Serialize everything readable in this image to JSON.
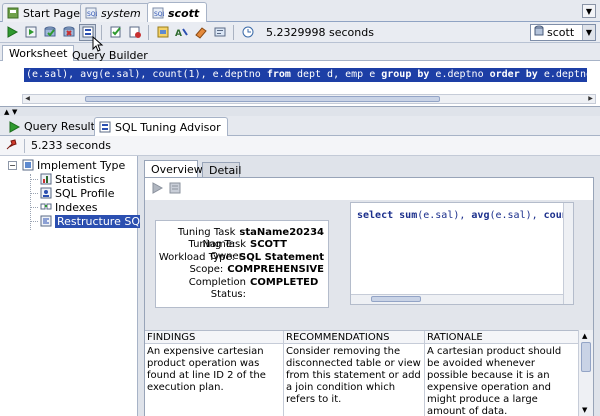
{
  "tabs": [
    {
      "label": "Start Page",
      "icon": "start-page-icon"
    },
    {
      "label": "system",
      "icon": "sql-worksheet-icon"
    },
    {
      "label": "scott",
      "icon": "sql-worksheet-icon"
    }
  ],
  "toolbar": {
    "elapsed": "5.2329998 seconds",
    "connection": "scott"
  },
  "worksheet_tabs": [
    "Worksheet",
    "Query Builder"
  ],
  "editor": {
    "sql_parts": [
      "(e.sal), avg(e.sal), count(1), e.deptno ",
      "from",
      " dept d, emp e ",
      "group by",
      " e.deptno ",
      "order by",
      " e.deptno;"
    ]
  },
  "result_tabs": [
    "Query Result",
    "SQL Tuning Advisor"
  ],
  "result_bar": {
    "time": "5.233 seconds"
  },
  "tree": {
    "root": "Implement Type",
    "items": [
      "Statistics",
      "SQL Profile",
      "Indexes",
      "Restructure SQL"
    ],
    "selected": "Restructure SQL"
  },
  "inner_tabs": [
    "Overview",
    "Detail"
  ],
  "task": {
    "rows": [
      {
        "label": "Tuning Task Name:",
        "value": "staName20234"
      },
      {
        "label": "Tuning Task Owner:",
        "value": "SCOTT"
      },
      {
        "label": "Workload Type:",
        "value": "SQL Statement"
      },
      {
        "label": "Scope:",
        "value": "COMPREHENSIVE"
      },
      {
        "label": "Completion Status:",
        "value": "COMPLETED"
      }
    ]
  },
  "sql_preview": {
    "parts": [
      "select",
      " ",
      "sum",
      "(e.sal), ",
      "avg",
      "(e.sal), ",
      "coun"
    ]
  },
  "findings": {
    "headers": [
      "FINDINGS",
      "RECOMMENDATIONS",
      "RATIONALE"
    ],
    "row": [
      "An expensive cartesian product operation was found at line ID 2 of the execution plan.",
      "Consider removing the disconnected table or view from this statement or add a join condition which refers to it.",
      "A cartesian product should be avoided whenever possible because it is an expensive operation and might produce a large amount of data."
    ]
  }
}
